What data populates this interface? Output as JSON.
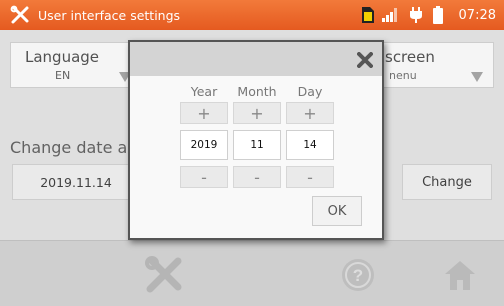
{
  "header": {
    "title": "User interface settings",
    "time": "07:28",
    "icons": [
      "tools-icon",
      "sd-card-icon",
      "signal-icon",
      "plug-icon",
      "battery-icon"
    ]
  },
  "background": {
    "language": {
      "caption": "Language",
      "value": "EN"
    },
    "screen": {
      "caption": "screen",
      "value": "nenu"
    },
    "date_section": {
      "title": "Change date a",
      "current_value": "2019.11.14",
      "change_label": "Change"
    }
  },
  "dialog": {
    "columns": [
      {
        "label": "Year",
        "plus": "+",
        "value": "2019",
        "minus": "-"
      },
      {
        "label": "Month",
        "plus": "+",
        "value": "11",
        "minus": "-"
      },
      {
        "label": "Day",
        "plus": "+",
        "value": "14",
        "minus": "-"
      }
    ],
    "ok_label": "OK"
  },
  "footer": {
    "buttons": [
      "settings-tools-icon",
      "help-icon",
      "home-icon"
    ]
  },
  "colors": {
    "accent": "#e8612a",
    "panel": "#ffffff",
    "dialog_header": "#d4d4d4"
  }
}
